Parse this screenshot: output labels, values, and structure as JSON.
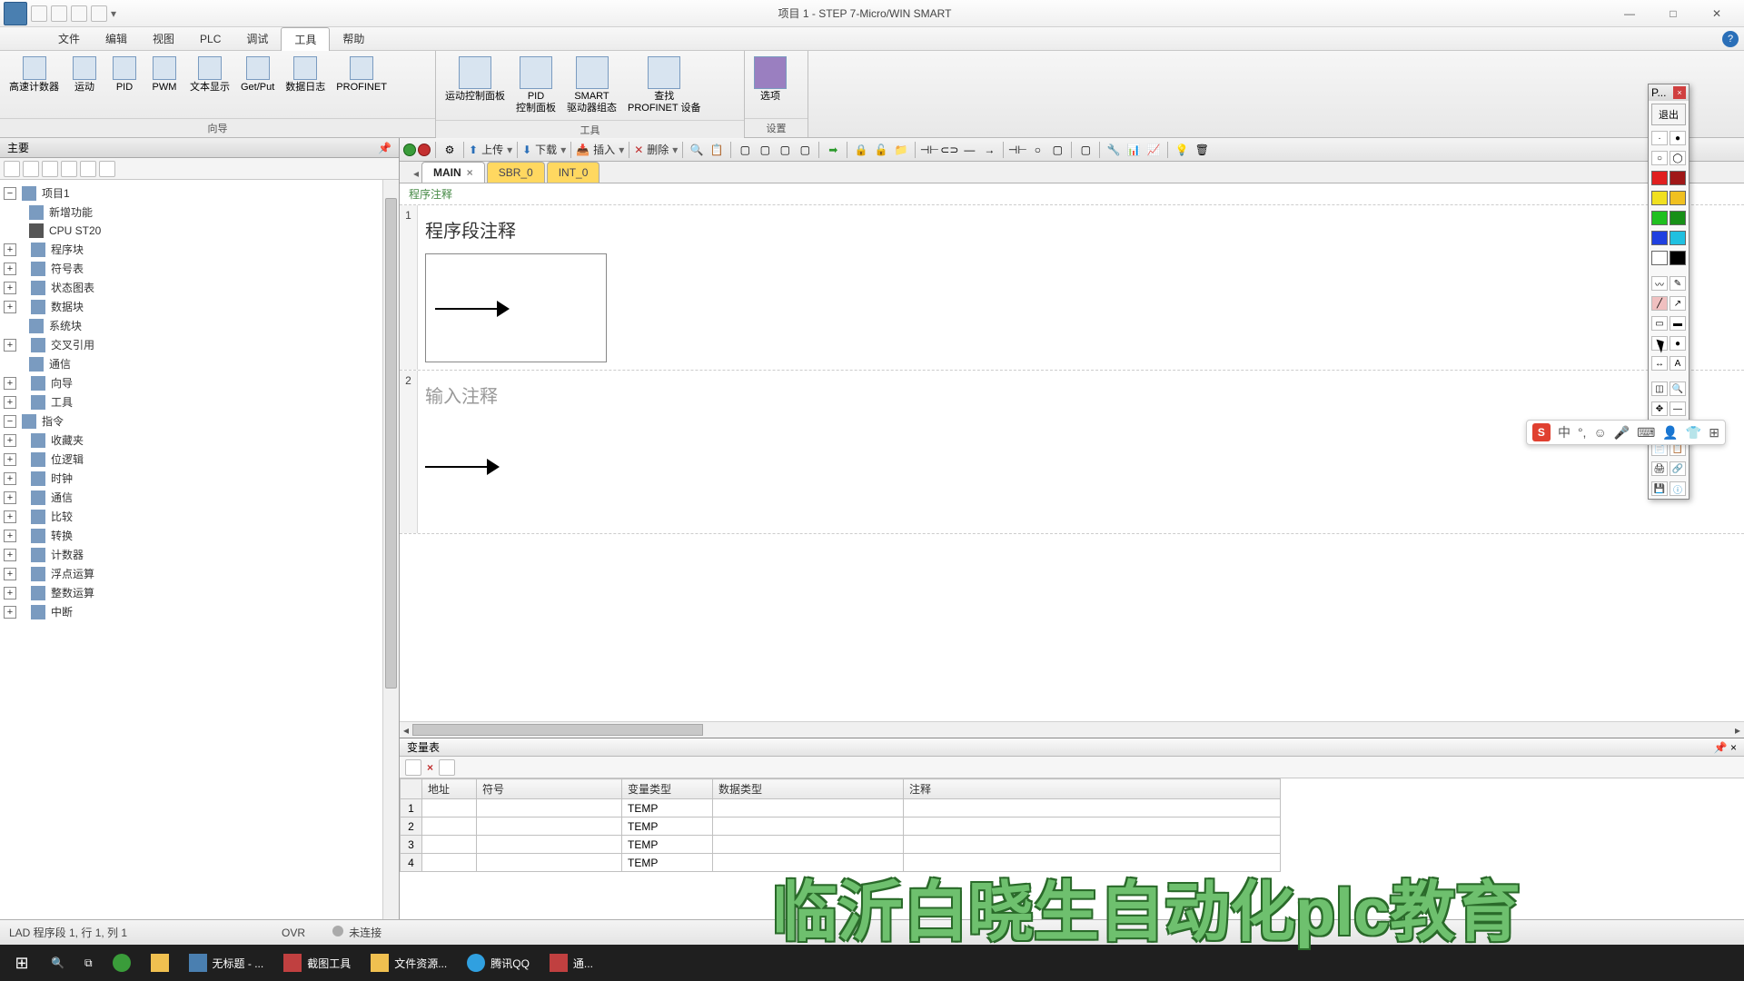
{
  "title": "项目 1 - STEP 7-Micro/WIN SMART",
  "menus": {
    "file": "文件",
    "edit": "编辑",
    "view": "视图",
    "plc": "PLC",
    "debug": "调试",
    "tools": "工具",
    "help": "帮助"
  },
  "ribbon": {
    "wizard_group": "向导",
    "tools_group": "工具",
    "settings_group": "设置",
    "items": {
      "hsc": "高速计数器",
      "motion": "运动",
      "pid": "PID",
      "pwm": "PWM",
      "text": "文本显示",
      "getput": "Get/Put",
      "datalog": "数据日志",
      "profinet": "PROFINET",
      "motion_panel": "运动控制面板",
      "pid_panel": "PID\n控制面板",
      "smart": "SMART\n驱动器组态",
      "find": "查找\nPROFINET 设备",
      "options": "选项"
    }
  },
  "left": {
    "title": "主要"
  },
  "tree": {
    "root": "项目1",
    "n1": "新增功能",
    "n2": "CPU ST20",
    "n3": "程序块",
    "n4": "符号表",
    "n5": "状态图表",
    "n6": "数据块",
    "n7": "系统块",
    "n8": "交叉引用",
    "n9": "通信",
    "n10": "向导",
    "n11": "工具",
    "n12": "指令",
    "n13": "收藏夹",
    "n14": "位逻辑",
    "n15": "时钟",
    "n16": "通信",
    "n17": "比较",
    "n18": "转换",
    "n19": "计数器",
    "n20": "浮点运算",
    "n21": "整数运算",
    "n22": "中断"
  },
  "editor": {
    "toolbar": {
      "upload": "上传",
      "download": "下载",
      "insert": "插入",
      "delete": "删除"
    },
    "tabs": {
      "main": "MAIN",
      "sbr": "SBR_0",
      "int": "INT_0"
    },
    "program_comment": "程序注释",
    "rung1_comment": "程序段注释",
    "rung2_placeholder": "输入注释"
  },
  "var_panel": {
    "title": "变量表",
    "cols": {
      "addr": "地址",
      "symbol": "符号",
      "vartype": "变量类型",
      "datatype": "数据类型",
      "comment": "注释"
    },
    "rows": [
      {
        "n": "1",
        "vt": "TEMP"
      },
      {
        "n": "2",
        "vt": "TEMP"
      },
      {
        "n": "3",
        "vt": "TEMP"
      },
      {
        "n": "4",
        "vt": "TEMP"
      }
    ]
  },
  "status": {
    "pos": "LAD 程序段 1, 行 1, 列 1",
    "ovr": "OVR",
    "conn": "未连接"
  },
  "float": {
    "title": "P...",
    "exit": "退出"
  },
  "ime": {
    "lang": "中"
  },
  "taskbar": {
    "untitled": "无标题 - ...",
    "snip": "截图工具",
    "explorer": "文件资源...",
    "qq": "腾讯QQ",
    "app5": "通..."
  },
  "watermark": "临沂白晓生自动化plc教育"
}
